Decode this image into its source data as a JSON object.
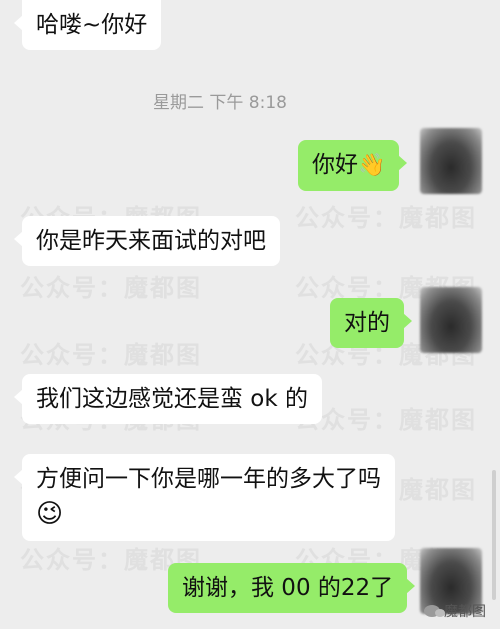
{
  "timestamp": "星期二 下午 8:18",
  "watermark_text": "公众号：魔都图",
  "messages": [
    {
      "side": "in",
      "text": "哈喽~你好",
      "emoji": ""
    },
    {
      "side": "out",
      "text": "你好",
      "emoji": "👋"
    },
    {
      "side": "in",
      "text": "你是昨天来面试的对吧",
      "emoji": ""
    },
    {
      "side": "out",
      "text": "对的",
      "emoji": ""
    },
    {
      "side": "in",
      "text": "我们这边感觉还是蛮 ok 的",
      "emoji": ""
    },
    {
      "side": "in",
      "text": "方便问一下你是哪一年的多大了吗",
      "emoji": "😉"
    },
    {
      "side": "out",
      "text": "谢谢，我 00 的22了",
      "emoji": ""
    }
  ],
  "brand": "魔都图",
  "colors": {
    "background": "#ededed",
    "outgoing": "#95ec69",
    "incoming": "#ffffff"
  }
}
